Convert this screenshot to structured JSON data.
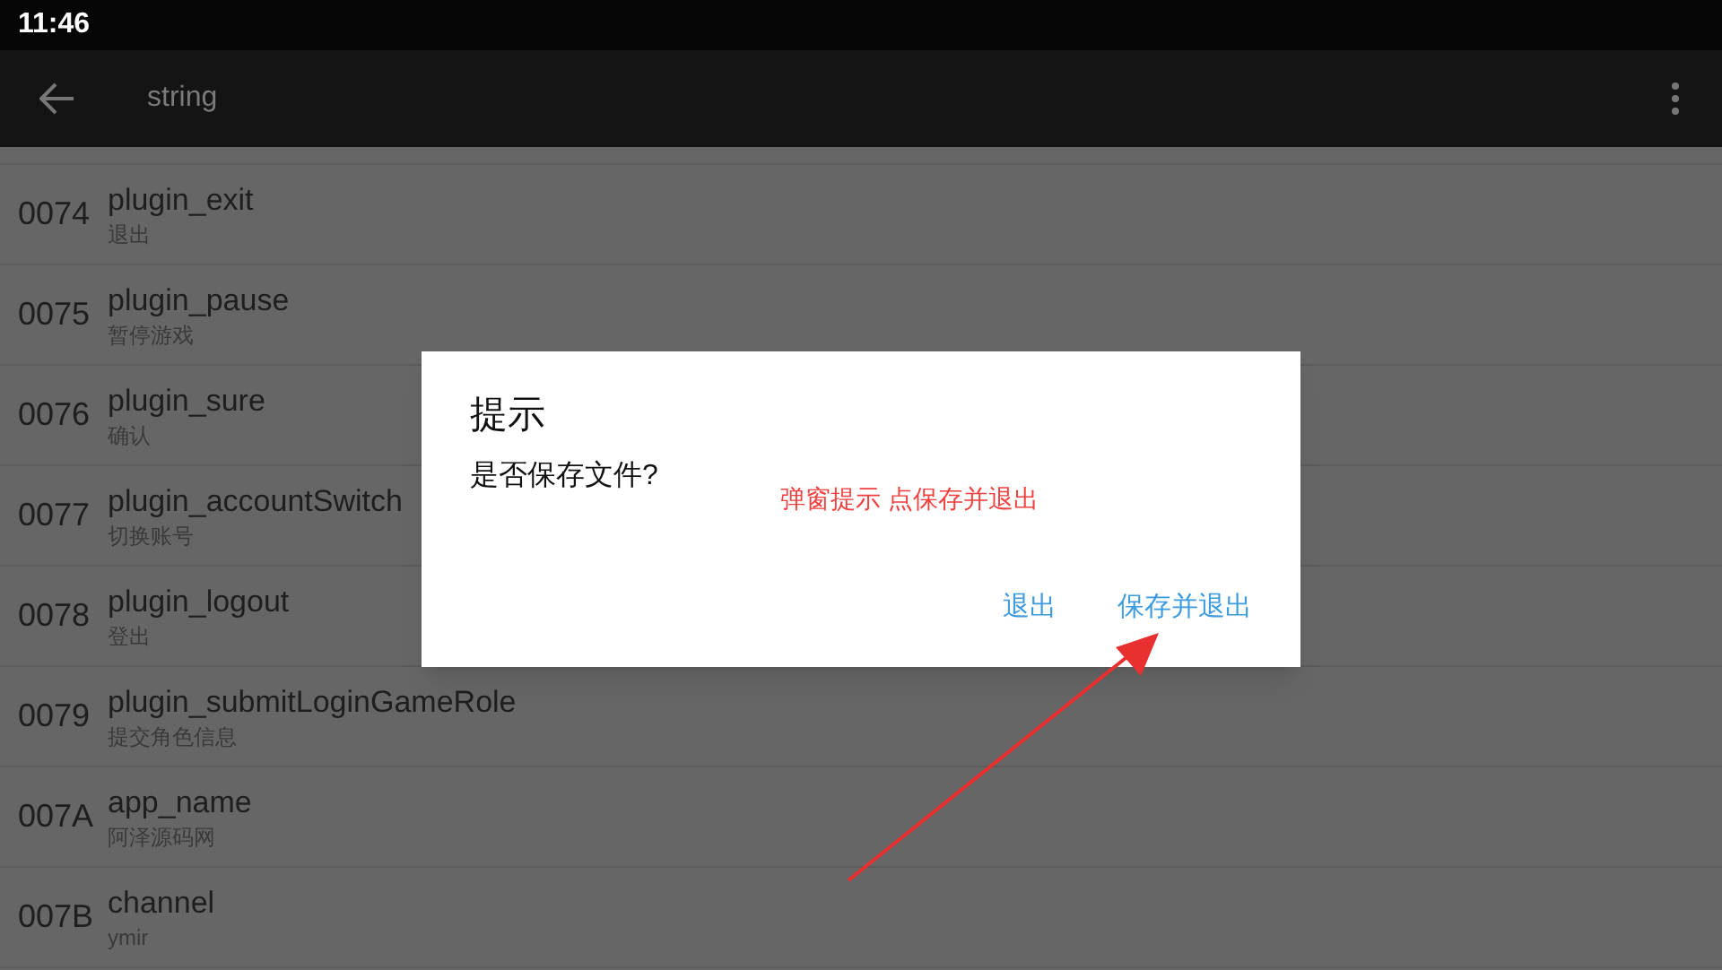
{
  "status_bar": {
    "time": "11:46"
  },
  "toolbar": {
    "title": "string"
  },
  "rows": [
    {
      "code": "0074",
      "name": "plugin_exit",
      "value": "退出"
    },
    {
      "code": "0075",
      "name": "plugin_pause",
      "value": "暂停游戏"
    },
    {
      "code": "0076",
      "name": "plugin_sure",
      "value": "确认"
    },
    {
      "code": "0077",
      "name": "plugin_accountSwitch",
      "value": "切换账号"
    },
    {
      "code": "0078",
      "name": "plugin_logout",
      "value": "登出"
    },
    {
      "code": "0079",
      "name": "plugin_submitLoginGameRole",
      "value": "提交角色信息"
    },
    {
      "code": "007A",
      "name": "app_name",
      "value": "阿泽源码网"
    },
    {
      "code": "007B",
      "name": "channel",
      "value": "ymir"
    }
  ],
  "dialog": {
    "title": "提示",
    "message": "是否保存文件?",
    "buttons": [
      "退出",
      "保存并退出"
    ]
  },
  "annotation": {
    "text": "弹窗提示 点保存并退出"
  }
}
